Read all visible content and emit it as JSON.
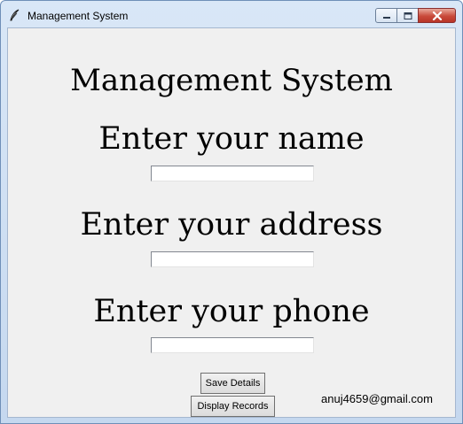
{
  "window": {
    "title": "Management System",
    "controls": {
      "minimize_icon": "minimize-icon",
      "maximize_icon": "maximize-icon",
      "close_icon": "close-icon"
    },
    "app_icon": "feather-icon"
  },
  "main": {
    "heading": "Management System",
    "name_label": "Enter your name",
    "name_value": "",
    "address_label": "Enter your address",
    "address_value": "",
    "phone_label": "Enter your phone",
    "phone_value": "",
    "save_button": "Save Details",
    "display_button": "Display Records",
    "email": "anuj4659@gmail.com"
  },
  "colors": {
    "client_background": "#f0f0f0",
    "close_button": "#c94a3a",
    "titlebar": "#d9e7f7"
  }
}
